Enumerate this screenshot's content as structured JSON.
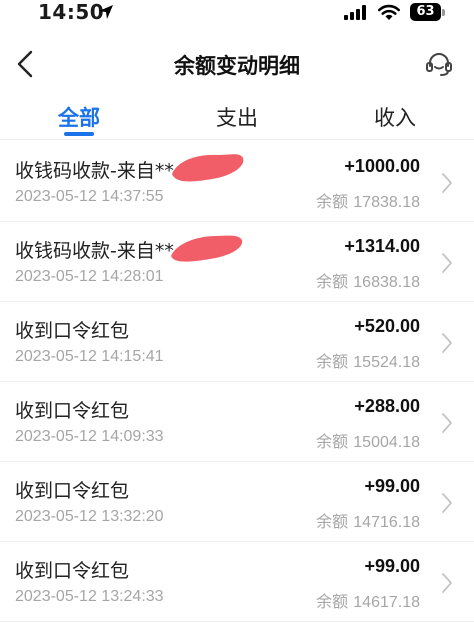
{
  "status": {
    "time": "14:50",
    "battery": "63"
  },
  "nav": {
    "title": "余额变动明细"
  },
  "tabs": [
    {
      "label": "全部",
      "active": true
    },
    {
      "label": "支出",
      "active": false
    },
    {
      "label": "收入",
      "active": false
    }
  ],
  "balance_label": "余额",
  "transactions": [
    {
      "title": "收钱码收款-来自**",
      "time": "2023-05-12 14:37:55",
      "amount": "+1000.00",
      "balance": "17838.18",
      "redacted": true
    },
    {
      "title": "收钱码收款-来自**",
      "time": "2023-05-12 14:28:01",
      "amount": "+1314.00",
      "balance": "16838.18",
      "redacted": true
    },
    {
      "title": "收到口令红包",
      "time": "2023-05-12 14:15:41",
      "amount": "+520.00",
      "balance": "15524.18",
      "redacted": false
    },
    {
      "title": "收到口令红包",
      "time": "2023-05-12 14:09:33",
      "amount": "+288.00",
      "balance": "15004.18",
      "redacted": false
    },
    {
      "title": "收到口令红包",
      "time": "2023-05-12 13:32:20",
      "amount": "+99.00",
      "balance": "14716.18",
      "redacted": false
    },
    {
      "title": "收到口令红包",
      "time": "2023-05-12 13:24:33",
      "amount": "+99.00",
      "balance": "14617.18",
      "redacted": false
    }
  ],
  "colors": {
    "accent": "#1a73e8",
    "redaction": "#f0505a"
  }
}
